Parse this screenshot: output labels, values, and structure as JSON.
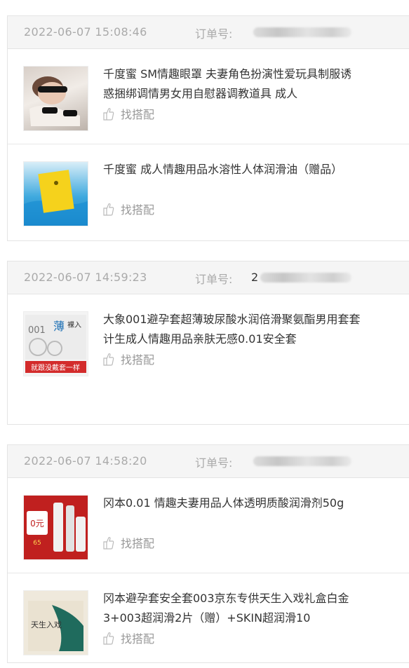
{
  "order_no_label": "订单号:",
  "match_label": "找搭配",
  "orders": [
    {
      "date": "2022-06-07 15:08:46",
      "order_no_visible": "",
      "items": [
        {
          "title": "千度蜜 SM情趣眼罩 夫妻角色扮演性爱玩具制服诱惑捆绑调情男女用自慰器调教道具 成人"
        },
        {
          "title": "千度蜜 成人情趣用品水溶性人体润滑油（赠品）"
        }
      ]
    },
    {
      "date": "2022-06-07 14:59:23",
      "order_no_visible": "2",
      "items": [
        {
          "title": "大象001避孕套超薄玻尿酸水润倍滑聚氨酯男用套套计生成人情趣用品亲肤无感0.01安全套"
        }
      ]
    },
    {
      "date": "2022-06-07 14:58:20",
      "order_no_visible": "",
      "items": [
        {
          "title": "冈本0.01 情趣夫妻用品人体透明质酸润滑剂50g"
        },
        {
          "title": "冈本避孕套安全套003京东专供天生入戏礼盒白金3+003超润滑2片（赠）+SKIN超润滑10"
        }
      ]
    }
  ],
  "thumbnails": {
    "t2_text": "",
    "t3_top": "001",
    "t3_big": "薄",
    "t3_side": "裸入",
    "t3_banner": "就跟没戴套一样",
    "t4_price": "0元",
    "t4_sub": "65",
    "t5_text": "天生入戏"
  },
  "colors": {
    "header_bg": "#f5f5f5",
    "border": "#e4e4e4",
    "muted_text": "#999999",
    "date_text": "#aaaaaa"
  }
}
